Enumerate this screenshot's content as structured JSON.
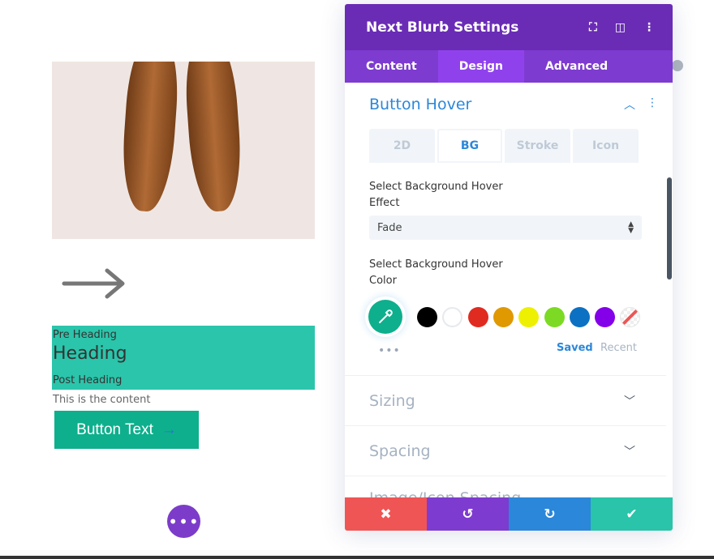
{
  "preview": {
    "pre_heading": "Pre Heading",
    "heading": "Heading",
    "post_heading": "Post Heading",
    "content": "This is the content",
    "button_text": "Button Text",
    "button_arrow": "→"
  },
  "panel": {
    "title": "Next Blurb Settings",
    "tabs": [
      {
        "label": "Content"
      },
      {
        "label": "Design",
        "active": true
      },
      {
        "label": "Advanced"
      }
    ],
    "section": {
      "title": "Button Hover"
    },
    "subtabs": [
      {
        "label": "2D"
      },
      {
        "label": "BG",
        "active": true
      },
      {
        "label": "Stroke"
      },
      {
        "label": "Icon"
      }
    ],
    "bg_effect": {
      "label_line1": "Select Background Hover",
      "label_line2": "Effect",
      "value": "Fade"
    },
    "bg_color": {
      "label_line1": "Select Background Hover",
      "label_line2": "Color",
      "current": "#0eaf8c",
      "swatches": [
        "#000000",
        "#ffffff",
        "#e02b20",
        "#e09900",
        "#edf000",
        "#7cda24",
        "#0c71c3",
        "#8300e9",
        "transparent"
      ],
      "saved": "Saved",
      "recent": "Recent"
    },
    "collapsed_sections": [
      {
        "title": "Sizing"
      },
      {
        "title": "Spacing"
      },
      {
        "title": "Image/Icon Spacing"
      }
    ],
    "footer_colors": {
      "cancel": "#ef5555",
      "undo": "#7e3bd0",
      "redo": "#2b87da",
      "save": "#29c4a9"
    }
  }
}
